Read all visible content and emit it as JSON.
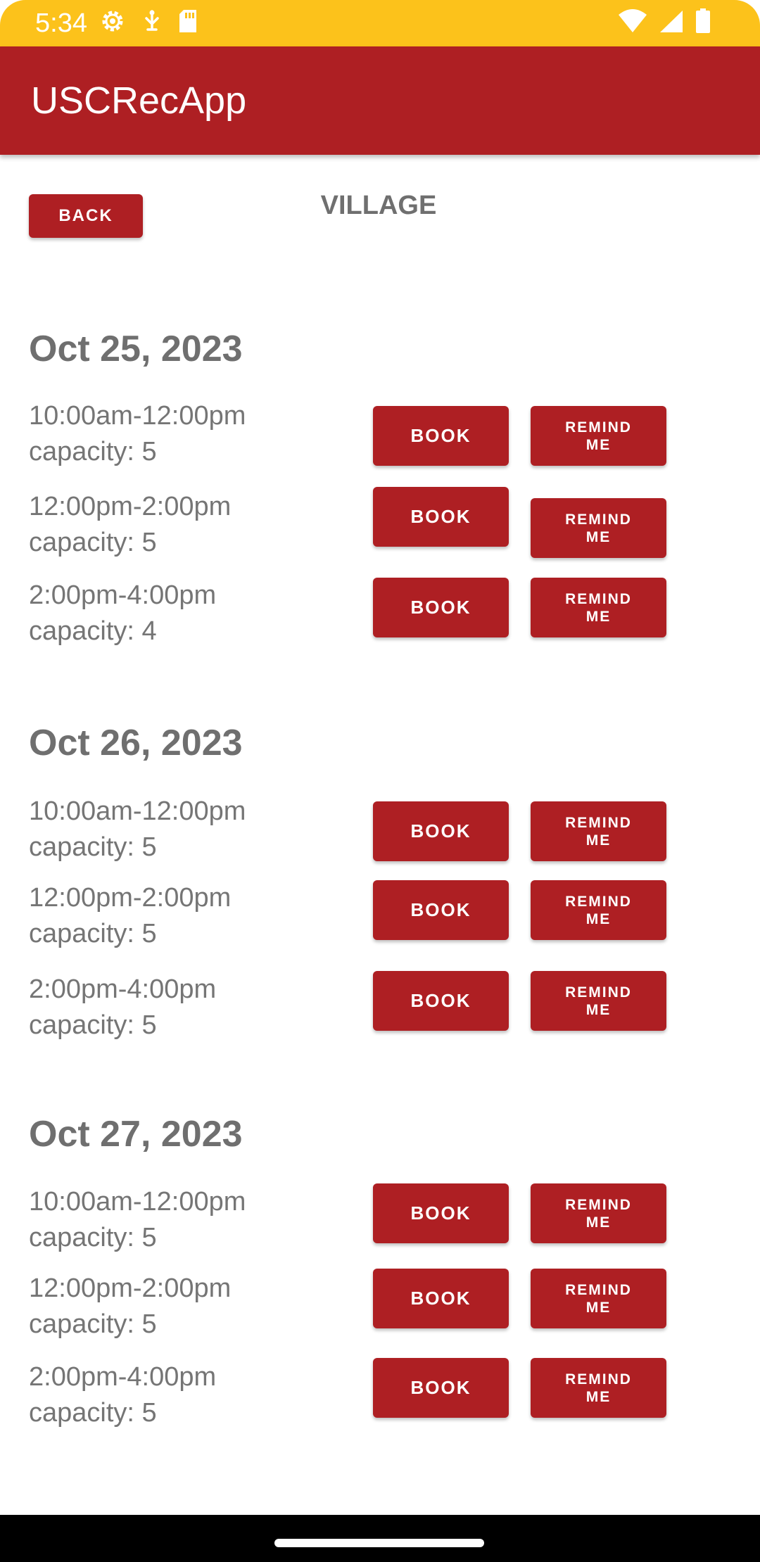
{
  "status_bar": {
    "time": "5:34",
    "background_color": "#FCC21B",
    "left_icons": [
      "settings-gear-icon",
      "usb-debug-icon",
      "sd-card-icon"
    ],
    "right_icons": [
      "wifi-icon",
      "cell-signal-icon",
      "battery-icon"
    ]
  },
  "app_bar": {
    "title": "USCRecApp",
    "background_color": "#AE1F23"
  },
  "header": {
    "back_label": "BACK",
    "page_title": "VILLAGE"
  },
  "days": [
    {
      "date": "Oct 25, 2023",
      "slots": [
        {
          "time": "10:00am-12:00pm",
          "capacity": "capacity: 5",
          "book_label": "BOOK",
          "remind_label": "REMIND ME"
        },
        {
          "time": "12:00pm-2:00pm",
          "capacity": "capacity: 5",
          "book_label": "BOOK",
          "remind_label": "REMIND ME"
        },
        {
          "time": "2:00pm-4:00pm",
          "capacity": "capacity: 4",
          "book_label": "BOOK",
          "remind_label": "REMIND ME"
        }
      ]
    },
    {
      "date": "Oct 26, 2023",
      "slots": [
        {
          "time": "10:00am-12:00pm",
          "capacity": "capacity: 5",
          "book_label": "BOOK",
          "remind_label": "REMIND ME"
        },
        {
          "time": "12:00pm-2:00pm",
          "capacity": "capacity: 5",
          "book_label": "BOOK",
          "remind_label": "REMIND ME"
        },
        {
          "time": "2:00pm-4:00pm",
          "capacity": "capacity: 5",
          "book_label": "BOOK",
          "remind_label": "REMIND ME"
        }
      ]
    },
    {
      "date": "Oct 27, 2023",
      "slots": [
        {
          "time": "10:00am-12:00pm",
          "capacity": "capacity: 5",
          "book_label": "BOOK",
          "remind_label": "REMIND ME"
        },
        {
          "time": "12:00pm-2:00pm",
          "capacity": "capacity: 5",
          "book_label": "BOOK",
          "remind_label": "REMIND ME"
        },
        {
          "time": "2:00pm-4:00pm",
          "capacity": "capacity: 5",
          "book_label": "BOOK",
          "remind_label": "REMIND ME"
        }
      ]
    }
  ]
}
